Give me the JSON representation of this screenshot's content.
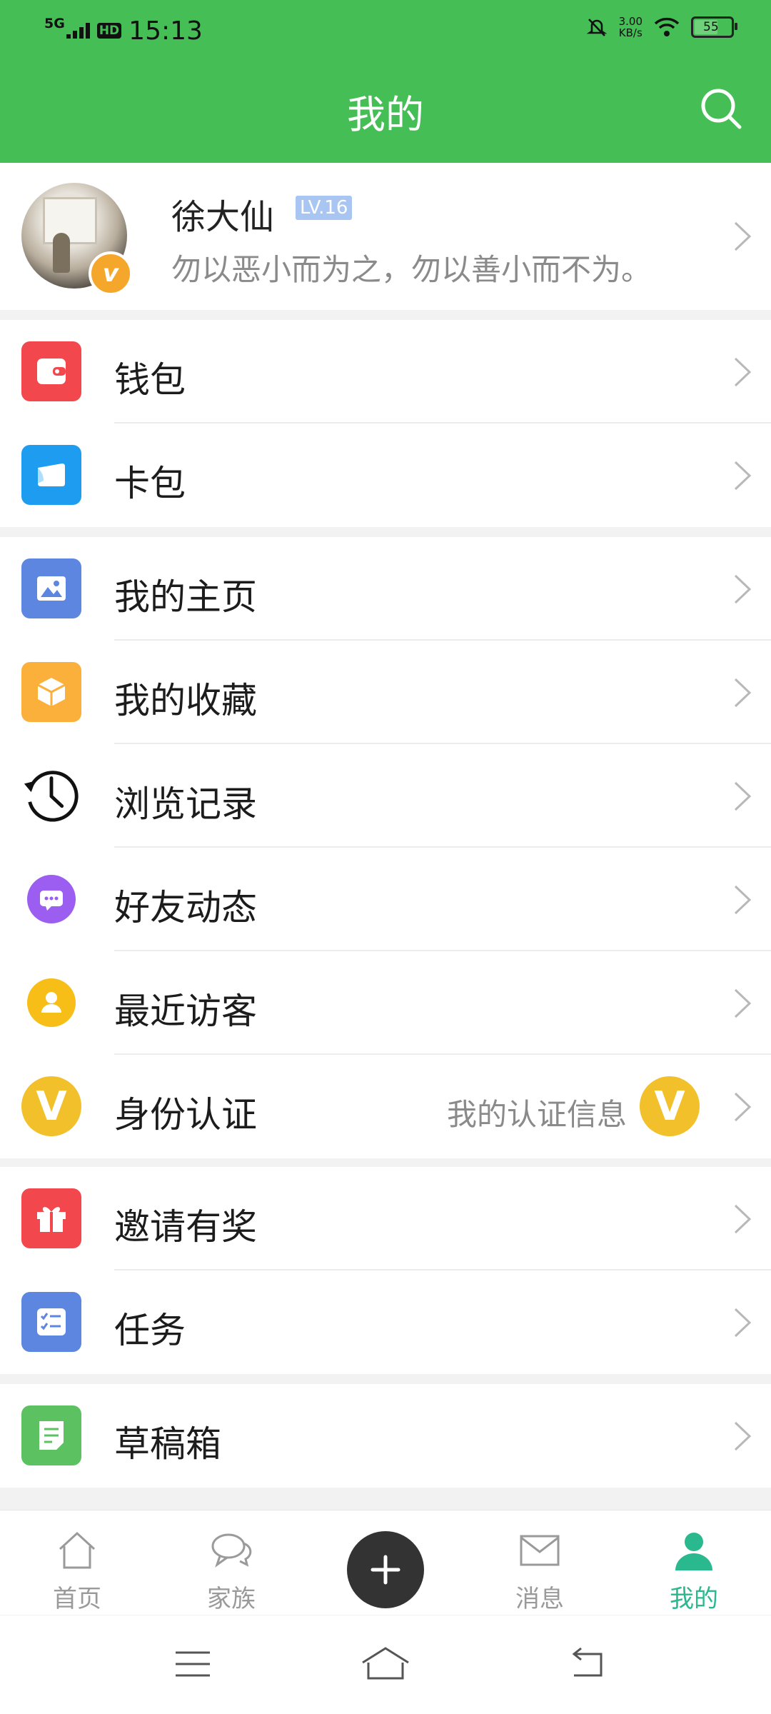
{
  "status_bar": {
    "network": "5G",
    "hd": "HD",
    "time": "15:13",
    "speed_value": "3.00",
    "speed_unit": "KB/s",
    "battery": "55"
  },
  "header": {
    "title": "我的"
  },
  "profile": {
    "name": "徐大仙",
    "level": "LV.16",
    "motto": "勿以恶小而为之，勿以善小而不为。"
  },
  "menu": {
    "group1": [
      {
        "label": "钱包"
      },
      {
        "label": "卡包"
      }
    ],
    "group2": [
      {
        "label": "我的主页"
      },
      {
        "label": "我的收藏"
      },
      {
        "label": "浏览记录"
      },
      {
        "label": "好友动态"
      },
      {
        "label": "最近访客"
      },
      {
        "label": "身份认证",
        "value": "我的认证信息"
      }
    ],
    "group3": [
      {
        "label": "邀请有奖"
      },
      {
        "label": "任务"
      }
    ],
    "group4": [
      {
        "label": "草稿箱"
      }
    ]
  },
  "tabs": [
    {
      "label": "首页"
    },
    {
      "label": "家族"
    },
    {
      "label": "消息"
    },
    {
      "label": "我的"
    }
  ],
  "colors": {
    "brand_green": "#45be55",
    "active_tab": "#2ab98f"
  }
}
